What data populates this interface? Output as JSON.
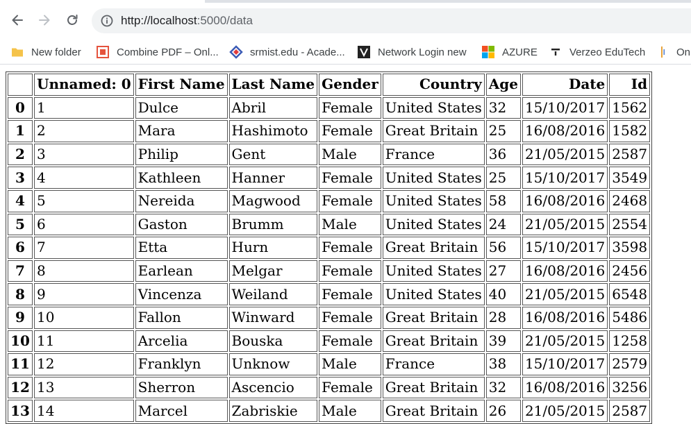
{
  "browser": {
    "url_host": "http://localhost",
    "url_rest": ":5000/data",
    "bookmarks": [
      {
        "label": "New folder",
        "icon": "folder-icon"
      },
      {
        "label": "Combine PDF – Onl...",
        "icon": "pdf-icon"
      },
      {
        "label": "srmist.edu - Acade...",
        "icon": "srm-icon"
      },
      {
        "label": "Network Login new",
        "icon": "network-icon"
      },
      {
        "label": "AZURE",
        "icon": "microsoft-icon"
      },
      {
        "label": "Verzeo EduTech",
        "icon": "verzeo-icon"
      },
      {
        "label": "Onl",
        "icon": "bookmark-icon"
      }
    ]
  },
  "table": {
    "columns": [
      "",
      "Unnamed: 0",
      "First Name",
      "Last Name",
      "Gender",
      "Country",
      "Age",
      "Date",
      "Id"
    ],
    "rows": [
      [
        "0",
        "1",
        "Dulce",
        "Abril",
        "Female",
        "United States",
        "32",
        "15/10/2017",
        "1562"
      ],
      [
        "1",
        "2",
        "Mara",
        "Hashimoto",
        "Female",
        "Great Britain",
        "25",
        "16/08/2016",
        "1582"
      ],
      [
        "2",
        "3",
        "Philip",
        "Gent",
        "Male",
        "France",
        "36",
        "21/05/2015",
        "2587"
      ],
      [
        "3",
        "4",
        "Kathleen",
        "Hanner",
        "Female",
        "United States",
        "25",
        "15/10/2017",
        "3549"
      ],
      [
        "4",
        "5",
        "Nereida",
        "Magwood",
        "Female",
        "United States",
        "58",
        "16/08/2016",
        "2468"
      ],
      [
        "5",
        "6",
        "Gaston",
        "Brumm",
        "Male",
        "United States",
        "24",
        "21/05/2015",
        "2554"
      ],
      [
        "6",
        "7",
        "Etta",
        "Hurn",
        "Female",
        "Great Britain",
        "56",
        "15/10/2017",
        "3598"
      ],
      [
        "7",
        "8",
        "Earlean",
        "Melgar",
        "Female",
        "United States",
        "27",
        "16/08/2016",
        "2456"
      ],
      [
        "8",
        "9",
        "Vincenza",
        "Weiland",
        "Female",
        "United States",
        "40",
        "21/05/2015",
        "6548"
      ],
      [
        "9",
        "10",
        "Fallon",
        "Winward",
        "Female",
        "Great Britain",
        "28",
        "16/08/2016",
        "5486"
      ],
      [
        "10",
        "11",
        "Arcelia",
        "Bouska",
        "Female",
        "Great Britain",
        "39",
        "21/05/2015",
        "1258"
      ],
      [
        "11",
        "12",
        "Franklyn",
        "Unknow",
        "Male",
        "France",
        "38",
        "15/10/2017",
        "2579"
      ],
      [
        "12",
        "13",
        "Sherron",
        "Ascencio",
        "Female",
        "Great Britain",
        "32",
        "16/08/2016",
        "3256"
      ],
      [
        "13",
        "14",
        "Marcel",
        "Zabriskie",
        "Male",
        "Great Britain",
        "26",
        "21/05/2015",
        "2587"
      ]
    ]
  }
}
